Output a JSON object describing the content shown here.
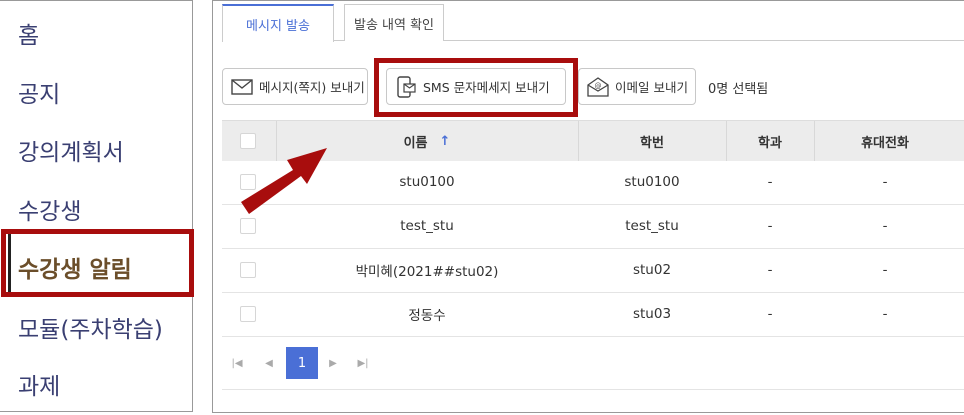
{
  "sidebar": {
    "items": [
      {
        "label": "홈"
      },
      {
        "label": "공지"
      },
      {
        "label": "강의계획서"
      },
      {
        "label": "수강생"
      },
      {
        "label": "수강생 알림"
      },
      {
        "label": "모듈(주차학습)"
      },
      {
        "label": "과제"
      }
    ],
    "active_index": 4
  },
  "tabs": [
    {
      "label": "메시지 발송"
    },
    {
      "label": "발송 내역 확인"
    }
  ],
  "toolbar": {
    "message_label": "메시지(쪽지) 보내기",
    "sms_label": "SMS 문자메세지 보내기",
    "email_label": "이메일 보내기",
    "selected_count": "0명 선택됨"
  },
  "table": {
    "columns": [
      {
        "label": "이름"
      },
      {
        "label": "학번"
      },
      {
        "label": "학과"
      },
      {
        "label": "휴대전화"
      }
    ],
    "sort_indicator": "↑",
    "rows": [
      {
        "name": "stu0100",
        "id": "stu0100",
        "dept": "-",
        "phone": "-"
      },
      {
        "name": "test_stu",
        "id": "test_stu",
        "dept": "-",
        "phone": "-"
      },
      {
        "name": "박미혜(2021##stu02)",
        "id": "stu02",
        "dept": "-",
        "phone": "-"
      },
      {
        "name": "정동수",
        "id": "stu03",
        "dept": "-",
        "phone": "-"
      }
    ]
  },
  "pagination": {
    "first": "|◀",
    "prev": "◀",
    "current_page": "1",
    "next": "▶",
    "last": "▶|"
  },
  "colors": {
    "accent": "#4a6fd6",
    "highlight": "#a80d0d",
    "menu_text": "#3a3f72",
    "active_menu_text": "#6b4e2a"
  }
}
